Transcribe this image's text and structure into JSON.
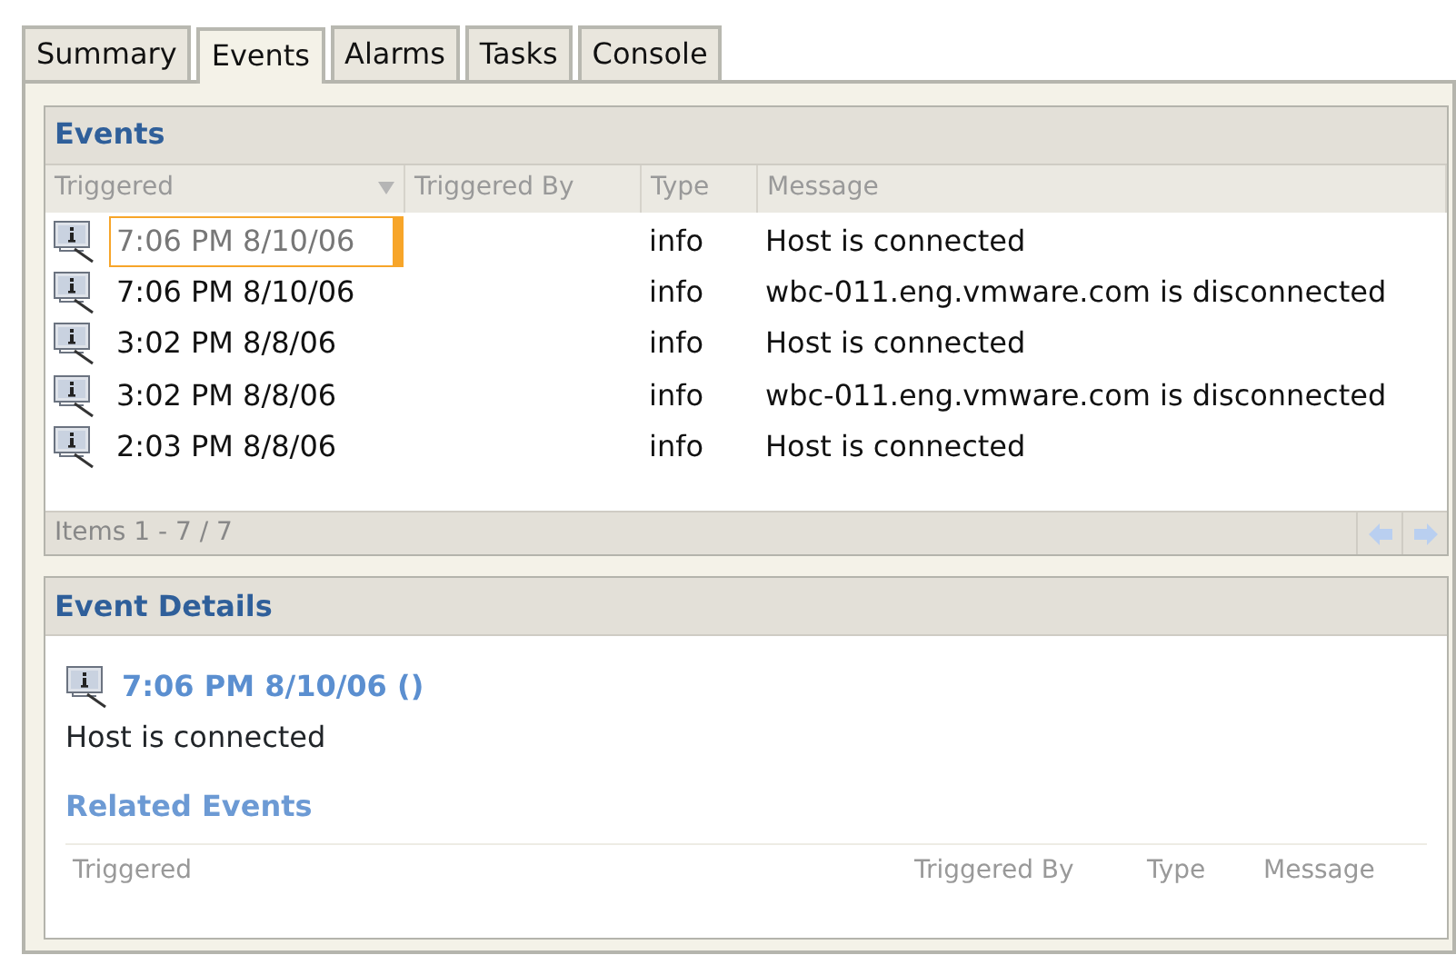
{
  "tabs": [
    {
      "label": "Summary",
      "selected": false
    },
    {
      "label": "Events",
      "selected": true
    },
    {
      "label": "Alarms",
      "selected": false
    },
    {
      "label": "Tasks",
      "selected": false
    },
    {
      "label": "Console",
      "selected": false
    }
  ],
  "events_panel": {
    "title": "Events",
    "columns": [
      {
        "label": "Triggered",
        "sorted": true
      },
      {
        "label": "Triggered By",
        "sorted": false
      },
      {
        "label": "Type",
        "sorted": false
      },
      {
        "label": "Message",
        "sorted": false
      }
    ],
    "rows": [
      {
        "triggered": "7:06 PM 8/10/06",
        "type": "info",
        "message": "Host is connected",
        "selected": true
      },
      {
        "triggered": "7:06 PM 8/10/06",
        "type": "info",
        "message": "wbc-011.eng.vmware.com is disconnected",
        "selected": false
      },
      {
        "triggered": "3:02 PM 8/8/06",
        "type": "info",
        "message": "Host is connected",
        "selected": false
      },
      {
        "triggered": "3:02 PM 8/8/06",
        "type": "info",
        "message": "wbc-011.eng.vmware.com is disconnected",
        "selected": false
      },
      {
        "triggered": "2:03 PM 8/8/06",
        "type": "info",
        "message": "Host is connected",
        "selected": false
      }
    ],
    "footer": "Items 1 - 7 / 7",
    "pager": {
      "previous_disabled": true,
      "next_disabled": true
    }
  },
  "details_panel": {
    "title": "Event Details",
    "event_heading": "7:06 PM 8/10/06 ()",
    "description": "Host is connected",
    "related_title": "Related Events",
    "related_columns": [
      "Triggered",
      "Triggered By",
      "Type",
      "Message"
    ]
  }
}
